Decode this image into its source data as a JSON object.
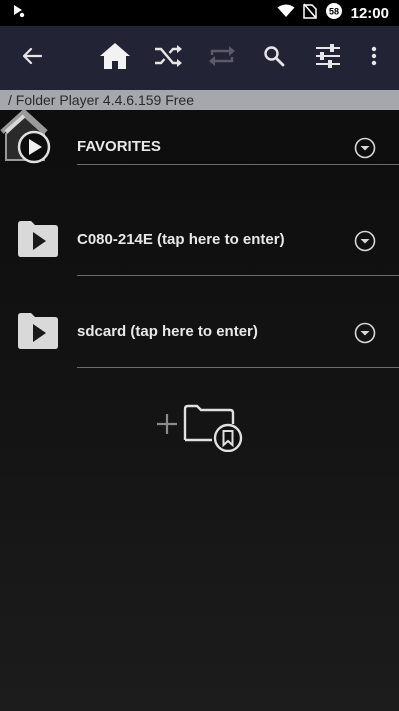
{
  "status_bar": {
    "clock": "12:00",
    "icons": [
      "play-notification-icon",
      "wifi-icon",
      "no-sim-icon",
      "data-saver-icon"
    ]
  },
  "toolbar": {
    "icons": [
      "back-arrow-icon",
      "home-icon",
      "shuffle-icon",
      "repeat-icon",
      "search-icon",
      "equalizer-icon",
      "more-vert-icon"
    ]
  },
  "path_bar": {
    "text": "/ Folder Player 4.4.6.159 Free"
  },
  "list": {
    "favorites_label": "FAVORITES",
    "items": [
      {
        "label": "C080-214E (tap here to enter)",
        "icon": "folder-play-icon"
      },
      {
        "label": "sdcard (tap here to enter)",
        "icon": "folder-play-icon"
      }
    ]
  },
  "add_favorite_icon": "add-folder-bookmark-icon",
  "colors": {
    "toolbar_bg": "#232336",
    "path_bar_bg": "#a6a6ad",
    "background": "#111111",
    "divider": "#6b6b6b",
    "text": "#e8e8e8"
  }
}
